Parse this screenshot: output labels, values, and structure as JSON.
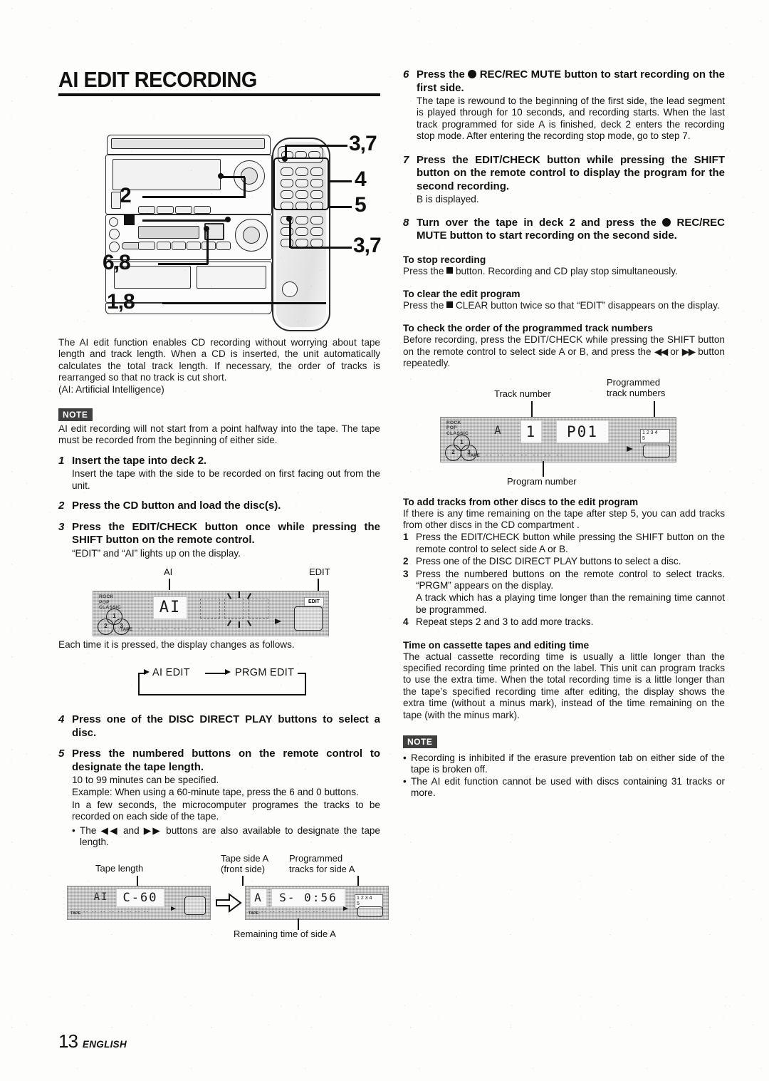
{
  "page": {
    "title": "AI EDIT RECORDING",
    "footer_page_number": "13",
    "footer_language": "ENGLISH"
  },
  "illustration": {
    "callouts": [
      {
        "name": "callout-2",
        "label": "2"
      },
      {
        "name": "callout-stop-square",
        "label": "■"
      },
      {
        "name": "callout-6-8",
        "label": "6,8"
      },
      {
        "name": "callout-1-8",
        "label": "1,8"
      },
      {
        "name": "callout-3-7-top",
        "label": "3,7"
      },
      {
        "name": "callout-4",
        "label": "4"
      },
      {
        "name": "callout-5",
        "label": "5"
      },
      {
        "name": "callout-3-7-bottom",
        "label": "3,7"
      }
    ]
  },
  "intro": {
    "paragraph": "The AI edit function enables CD recording without worrying about tape length and track length.  When a CD is inserted, the unit automatically calculates the total track length.  If necessary, the order of tracks is rearranged so that no track is cut short.",
    "abbreviation": "(AI: Artificial Intelligence)"
  },
  "note_top": {
    "badge": "NOTE",
    "text": "AI edit recording will not start from a point halfway into the tape. The tape must be recorded from the beginning of either side."
  },
  "steps_left": [
    {
      "num": "1",
      "heading": "Insert the tape into deck 2.",
      "text": "Insert the tape with the side to be recorded on first facing out from the unit."
    },
    {
      "num": "2",
      "heading": "Press the CD button and load the disc(s).",
      "text": ""
    },
    {
      "num": "3",
      "heading": "Press the EDIT/CHECK button once while pressing the SHIFT button on the remote control.",
      "text": "“EDIT” and “AI” lights up on the display."
    },
    {
      "num": "4",
      "heading": "Press one of the DISC DIRECT PLAY buttons to select a disc.",
      "text": ""
    },
    {
      "num": "5",
      "heading": "Press the numbered buttons on the remote control to designate the tape length.",
      "text": "10 to 99 minutes can be specified.",
      "text2": "Example:  When using a 60-minute tape, press the 6 and 0 buttons.",
      "text3": "In a few seconds, the microcomputer programes the tracks to be recorded on each side of the tape.",
      "bullet": "The ◀◀ and ▶▶ buttons are also available to designate the tape length."
    }
  ],
  "display_fig_1": {
    "label_ai": "AI",
    "label_edit": "EDIT",
    "mode_labels": [
      "ROCK",
      "POP",
      "CLASSIC"
    ],
    "disc_numbers": [
      "1",
      "2",
      "3"
    ],
    "segment_value": "AI",
    "badge": "EDIT",
    "tape_label": "TAPE",
    "track_dashes": "-- -- -- -- -- -- -- -- --"
  },
  "display_change_caption": "Each time it is pressed, the display changes as follows.",
  "flow": {
    "item1": "AI EDIT",
    "item2": "PRGM EDIT"
  },
  "display_fig_2": {
    "label_tape_length": "Tape length",
    "label_tape_side": "Tape side A\n(front side)",
    "label_tape_side_line1": "Tape side A",
    "label_tape_side_line2": "(front side)",
    "label_programmed_tracks_line1": "Programmed",
    "label_programmed_tracks_line2": "tracks for side A",
    "label_remaining": "Remaining time of side A",
    "left_panel": {
      "prefix": "AI",
      "segment_value": "C-60",
      "tape_label": "TAPE",
      "track_dashes": "-- -- -- -- -- -- -- --"
    },
    "right_panel": {
      "prefix": "A",
      "segment_value": "S- 0:56",
      "tape_label": "TAPE",
      "track_dashes": "-- -- -- -- -- -- -- --",
      "track_numbers_line1": "1 2 3 4",
      "track_numbers_line2": "5"
    }
  },
  "steps_right": [
    {
      "num": "6",
      "heading_pre": "Press the",
      "heading_icon": "record-dot",
      "heading_post": "REC/REC MUTE button to start recording on the first side.",
      "text": "The tape is rewound to the beginning of the first side, the lead segment is played through for 10 seconds, and recording starts. When the last track programmed for side A is finished, deck 2 enters the recording stop mode. After entering the recording stop mode, go to step 7."
    },
    {
      "num": "7",
      "heading": "Press the EDIT/CHECK button while pressing the SHIFT button on the remote control to display the program for the second recording.",
      "text": "B is displayed."
    },
    {
      "num": "8",
      "heading_pre": "Turn over the tape in deck 2 and press the",
      "heading_icon": "record-dot",
      "heading_post": "REC/REC MUTE button to start recording on the second side.",
      "text": ""
    }
  ],
  "sections_right": [
    {
      "heading": "To stop recording",
      "text_pre": "Press the",
      "icon": "stop-square",
      "text_post": "button. Recording and CD play stop simultaneously."
    },
    {
      "heading": "To clear the edit program",
      "text_pre": "Press the",
      "icon": "stop-square",
      "text_post": "CLEAR button twice so that “EDIT” disappears on the display."
    },
    {
      "heading": "To check the order of the programmed track numbers",
      "text_pre": "Before recording, press the EDIT/CHECK while pressing the SHIFT button on the remote control to select side A or B, and press the",
      "icon": "rew-ff",
      "text_post": "button repeatedly."
    }
  ],
  "display_fig_3": {
    "label_track_number": "Track number",
    "label_programmed_line1": "Programmed",
    "label_programmed_line2": "track numbers",
    "label_program_number": "Program number",
    "mode_labels": [
      "ROCK",
      "POP",
      "CLASSIC"
    ],
    "disc_numbers": [
      "1",
      "2",
      "3"
    ],
    "prefix": "A",
    "track_value": "1",
    "program_value": "P01",
    "track_numbers_line1": "1 2 3 4",
    "track_numbers_line2": "5",
    "tape_label": "TAPE",
    "track_dashes": "-- -- -- -- -- -- -- -- --"
  },
  "add_tracks": {
    "heading": "To add tracks from other discs to the edit program",
    "intro": "If there is any time remaining on the tape after step 5, you can add tracks from other discs in the CD compartment .",
    "items": [
      {
        "n": "1",
        "t": "Press the EDIT/CHECK button while pressing the SHIFT button on the remote control to select side A or B."
      },
      {
        "n": "2",
        "t": "Press one of the DISC DIRECT PLAY buttons to select a disc."
      },
      {
        "n": "3",
        "t": "Press the numbered buttons on the remote control to select tracks. “PRGM” appears on the display."
      },
      {
        "n": "",
        "t": "A track which has a playing time longer than the remaining time cannot be programmed."
      },
      {
        "n": "4",
        "t": "Repeat steps 2 and 3 to add more tracks."
      }
    ]
  },
  "editing_time": {
    "heading": "Time on cassette tapes and editing time",
    "text": "The actual cassette recording time is usually a little longer than the specified recording time printed on the label.  This unit can program tracks to use the extra time.  When the total recording time is a little longer than the tape’s specified recording time after editing, the display shows the extra time (without a minus mark), instead of the time remaining on the tape (with the minus mark)."
  },
  "note_bottom": {
    "badge": "NOTE",
    "bullets": [
      "Recording is inhibited if the erasure prevention tab on either side of the tape is broken off.",
      "The AI edit function cannot be used with discs containing 31 tracks or more."
    ]
  },
  "colors": {
    "ink": "#111111",
    "paper": "#fdfdfb",
    "lcd_background": "#b9b9b9",
    "badge_background": "#3f3f3f"
  }
}
